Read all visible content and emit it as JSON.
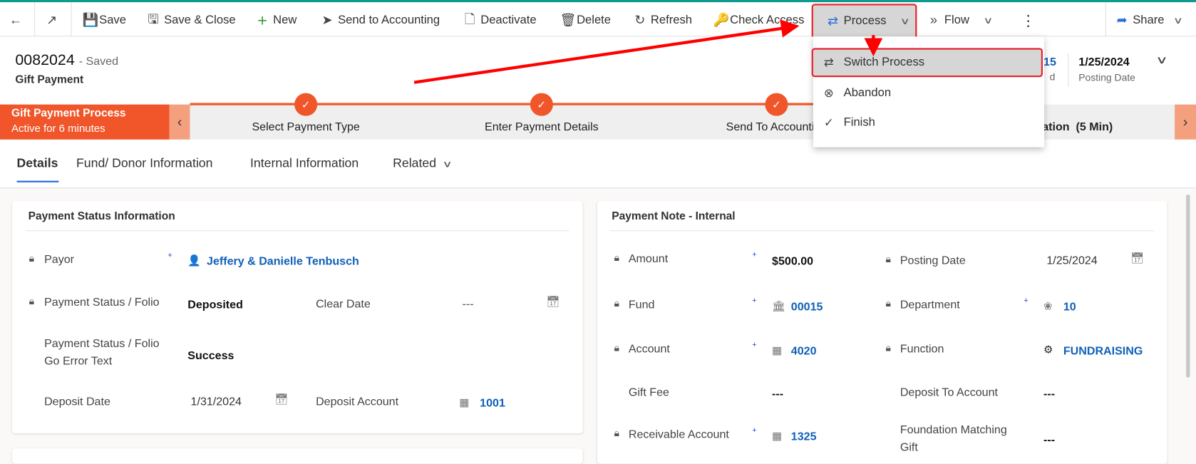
{
  "toolbar": {
    "back_icon": "arrow-left-icon",
    "popout_icon": "open-in-window-icon",
    "save": "Save",
    "save_close": "Save & Close",
    "new": "New",
    "send_to_accounting": "Send to Accounting",
    "deactivate": "Deactivate",
    "delete": "Delete",
    "refresh": "Refresh",
    "check_access": "Check Access",
    "process": "Process",
    "flow": "Flow",
    "share": "Share"
  },
  "header": {
    "record_id": "0082024",
    "save_status": "- Saved",
    "entity": "Gift Payment",
    "partial_field_value": "15",
    "partial_field_label": "d",
    "posting_date_value": "1/25/2024",
    "posting_date_label": "Posting Date"
  },
  "process_bar": {
    "name": "Gift Payment Process",
    "duration": "Active for 6 minutes",
    "stages": [
      {
        "label": "Select Payment Type",
        "completed": true
      },
      {
        "label": "Enter Payment Details",
        "completed": true
      },
      {
        "label": "Send To Accounting",
        "completed": true
      },
      {
        "label": "nation  (5 Min)",
        "completed": false
      }
    ],
    "accent_color": "#f0562a"
  },
  "process_menu": {
    "items": [
      {
        "label": "Switch Process",
        "icon": "shuffle-icon",
        "highlighted": true
      },
      {
        "label": "Abandon",
        "icon": "circle-x-icon"
      },
      {
        "label": "Finish",
        "icon": "checkmark-icon"
      }
    ]
  },
  "tabs": [
    {
      "label": "Details",
      "active": true
    },
    {
      "label": "Fund/ Donor Information"
    },
    {
      "label": "Internal Information"
    },
    {
      "label": "Related"
    }
  ],
  "payment_status": {
    "title": "Payment Status Information",
    "payor_label": "Payor",
    "payor_value": "Jeffery & Danielle Tenbusch",
    "status_label": "Payment Status / Folio",
    "status_value": "Deposited",
    "clear_date_label": "Clear Date",
    "clear_date_value": "---",
    "error_label_1": "Payment Status / Folio",
    "error_label_2": "Go Error Text",
    "error_value": "Success",
    "deposit_date_label": "Deposit Date",
    "deposit_date_value": "1/31/2024",
    "deposit_account_label": "Deposit Account",
    "deposit_account_value": "1001"
  },
  "payment_note": {
    "title": "Payment Note - Internal",
    "amount_label": "Amount",
    "amount_value": "$500.00",
    "posting_date_label": "Posting Date",
    "posting_date_value": "1/25/2024",
    "fund_label": "Fund",
    "fund_value": "00015",
    "department_label": "Department",
    "department_value": "10",
    "account_label": "Account",
    "account_value": "4020",
    "function_label": "Function",
    "function_value": "FUNDRAISING",
    "gift_fee_label": "Gift Fee",
    "gift_fee_value": "---",
    "deposit_to_label": "Deposit To Account",
    "deposit_to_value": "---",
    "receivable_label": "Receivable Account",
    "receivable_value": "1325",
    "matching_label_1": "Foundation Matching",
    "matching_label_2": "Gift",
    "matching_value": "---"
  },
  "colors": {
    "link": "#1160b7",
    "annotation": "#e8202a",
    "tab_underline": "#2266e3"
  }
}
